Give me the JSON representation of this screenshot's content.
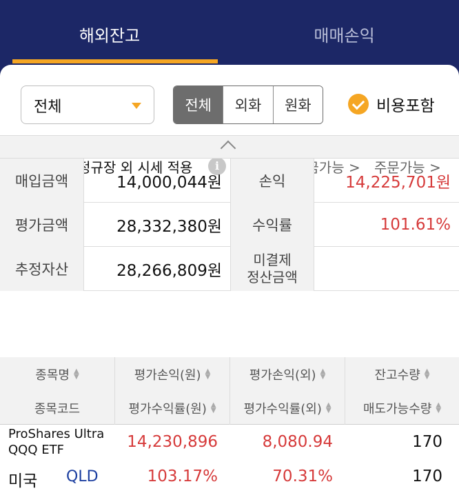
{
  "tabs": [
    {
      "label": "해외잔고",
      "active": true
    },
    {
      "label": "매매손익",
      "active": false
    }
  ],
  "filter": {
    "dropdown_value": "전체",
    "segments": [
      "전체",
      "외화",
      "원화"
    ],
    "selected_segment": "전체",
    "include_fees_label": "비용포함",
    "include_fees_checked": true,
    "us_extended_label": "미국 정규장 외 시세 적용",
    "us_extended_checked": true,
    "info_icon": "i",
    "withdraw_link": "출금가능 >",
    "order_link": "주문가능 >"
  },
  "summary": {
    "purchase_label": "매입금액",
    "purchase_value": "14,000,044원",
    "pnl_label": "손익",
    "pnl_value": "14,225,701원",
    "eval_label": "평가금액",
    "eval_value": "28,332,380원",
    "return_label": "수익률",
    "return_value": "101.61%",
    "est_label": "추정자산",
    "est_value": "28,266,809원",
    "unsettled_label_1": "미결제",
    "unsettled_label_2": "정산금액",
    "unsettled_value": ""
  },
  "holdings_header": {
    "c1r1": "종목명",
    "c2r1": "평가손익(원)",
    "c3r1": "평가손익(외)",
    "c4r1": "잔고수량",
    "c1r2": "종목코드",
    "c2r2": "평가수익률(원)",
    "c3r2": "평가수익률(외)",
    "c4r2": "매도가능수량"
  },
  "holdings": [
    {
      "name": "ProShares Ultra QQQ ETF",
      "market": "미국",
      "code": "QLD",
      "pnl_krw": "14,230,896",
      "pnl_fx": "8,080.94",
      "qty": "170",
      "return_krw": "103.17%",
      "return_fx": "70.31%",
      "sellable_qty": "170"
    }
  ],
  "colors": {
    "header_bg": "#1c2766",
    "accent": "#f5a623",
    "profit": "#d63a3a",
    "code_link": "#1c3fa0"
  }
}
